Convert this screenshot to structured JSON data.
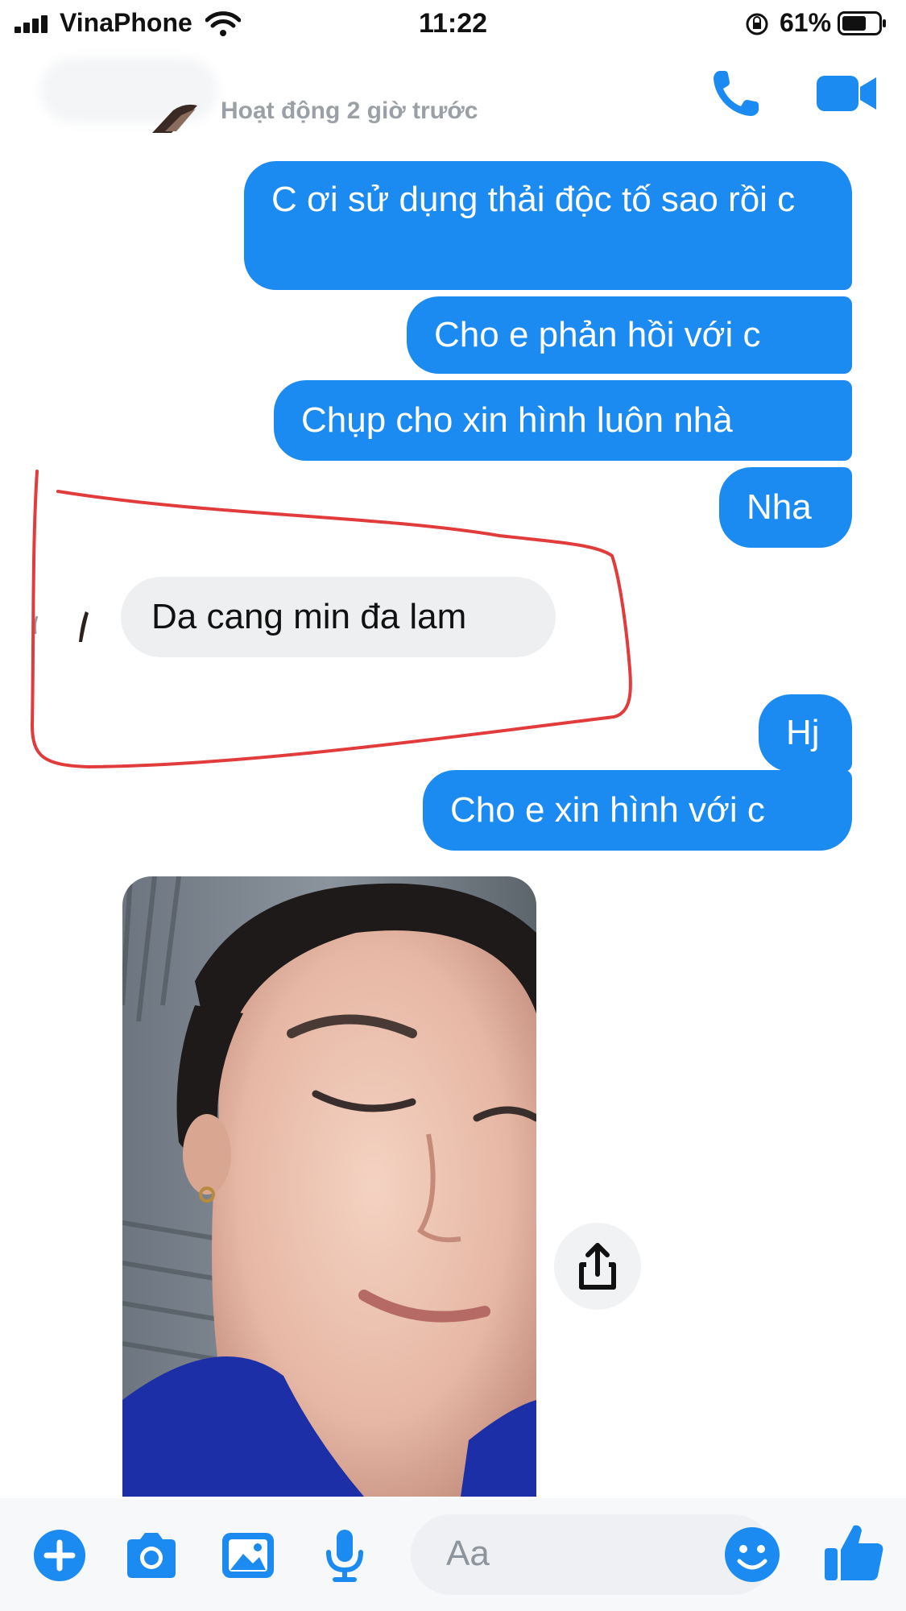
{
  "status_bar": {
    "carrier": "VinaPhone",
    "time": "11:22",
    "battery_percent": "61%"
  },
  "header": {
    "activity": "Hoạt động 2 giờ trước"
  },
  "messages": [
    {
      "direction": "outgoing",
      "text": "C ơi sử dụng thải độc tố sao rồi c"
    },
    {
      "direction": "outgoing",
      "text": "Cho e phản hồi với c"
    },
    {
      "direction": "outgoing",
      "text": "Chụp cho xin hình luôn nhà"
    },
    {
      "direction": "outgoing",
      "text": "Nha"
    },
    {
      "direction": "incoming",
      "text": "Da cang min đa lam"
    },
    {
      "direction": "outgoing",
      "text": "Hj"
    },
    {
      "direction": "outgoing",
      "text": "Cho e xin hình với c"
    }
  ],
  "composer": {
    "placeholder": "Aa"
  },
  "colors": {
    "accent": "#1b8bf2",
    "outgoing_bubble": "#1b8bf2",
    "incoming_bubble": "#eeeff1",
    "annotation": "#e23b3b"
  },
  "icons": {
    "header": [
      "phone-icon",
      "video-camera-icon"
    ],
    "toolbar": [
      "plus-icon",
      "camera-icon",
      "gallery-icon",
      "microphone-icon",
      "emoji-icon",
      "thumbs-up-icon"
    ],
    "photo": [
      "share-icon"
    ]
  }
}
